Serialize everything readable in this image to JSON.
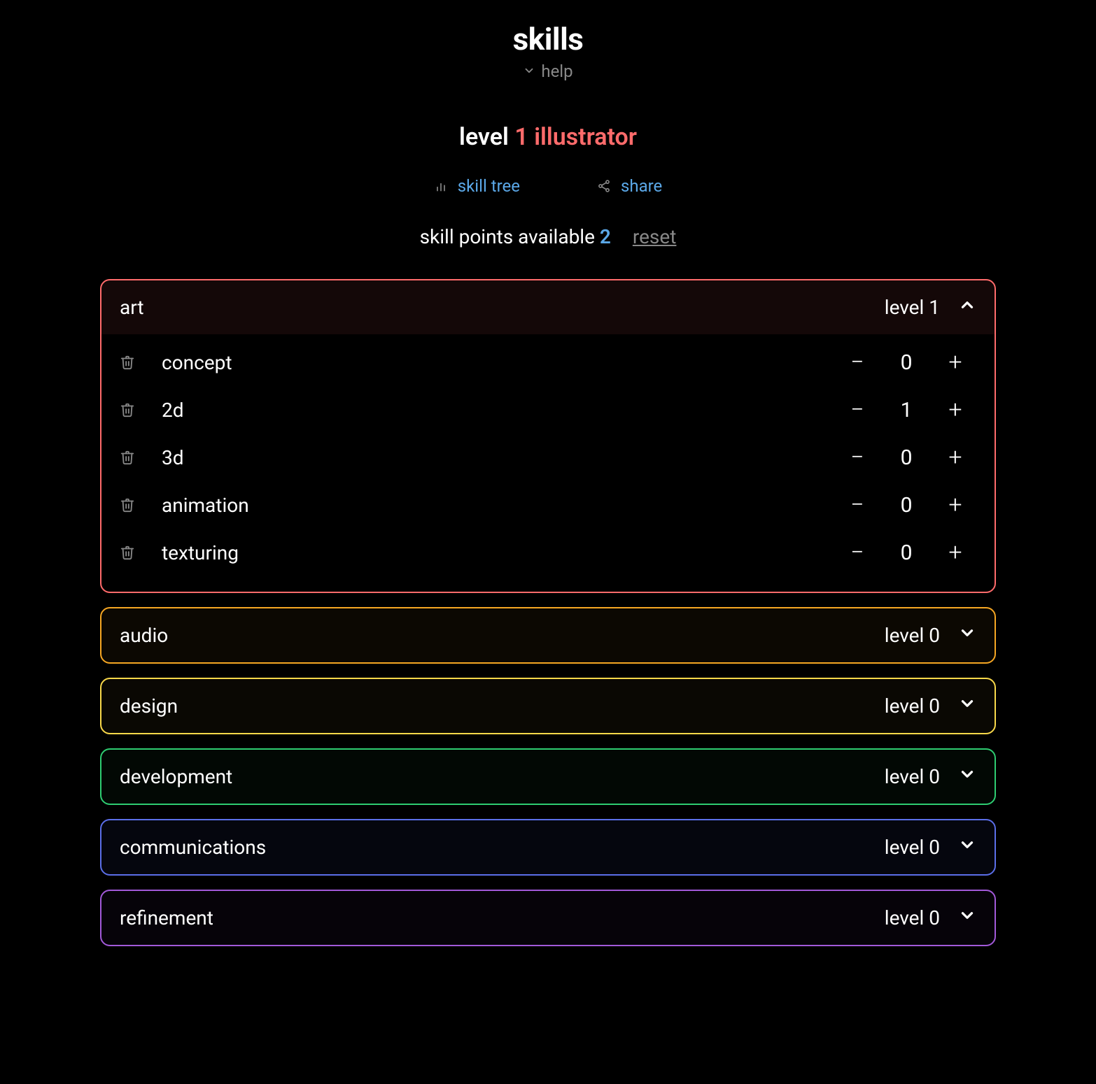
{
  "header": {
    "title": "skills",
    "help_label": "help"
  },
  "level_line": {
    "prefix": "level ",
    "value": "1 illustrator"
  },
  "links": {
    "skill_tree": "skill tree",
    "share": "share"
  },
  "points": {
    "label": "skill points available ",
    "count": "2",
    "reset": "reset"
  },
  "level_word": "level",
  "categories": [
    {
      "key": "art",
      "name": "art",
      "level": "1",
      "expanded": true,
      "skills": [
        {
          "name": "concept",
          "value": "0"
        },
        {
          "name": "2d",
          "value": "1"
        },
        {
          "name": "3d",
          "value": "0"
        },
        {
          "name": "animation",
          "value": "0"
        },
        {
          "name": "texturing",
          "value": "0"
        }
      ]
    },
    {
      "key": "audio",
      "name": "audio",
      "level": "0",
      "expanded": false
    },
    {
      "key": "design",
      "name": "design",
      "level": "0",
      "expanded": false
    },
    {
      "key": "development",
      "name": "development",
      "level": "0",
      "expanded": false
    },
    {
      "key": "communications",
      "name": "communications",
      "level": "0",
      "expanded": false
    },
    {
      "key": "refinement",
      "name": "refinement",
      "level": "0",
      "expanded": false
    }
  ]
}
